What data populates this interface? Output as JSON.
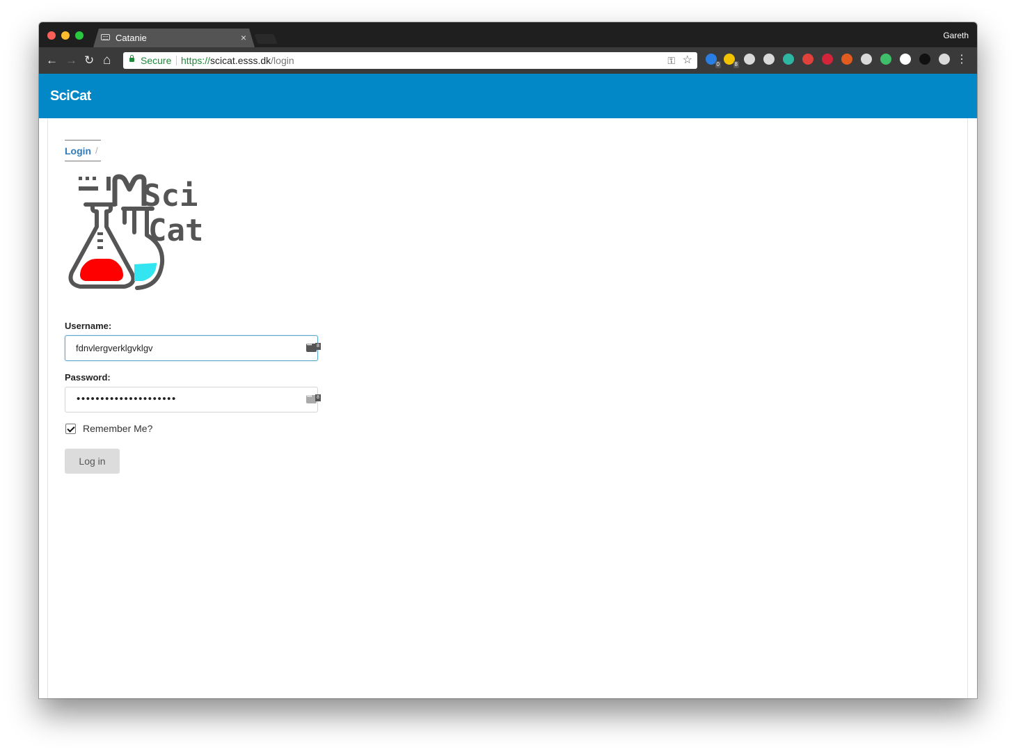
{
  "browser": {
    "tab_title": "Catanie",
    "tab_close": "×",
    "profile_name": "Gareth",
    "omnibox": {
      "secure_label": "Secure",
      "url_scheme": "https://",
      "url_host": "scicat.esss.dk",
      "url_path": "/login"
    },
    "nav": {
      "back": "←",
      "forward": "→",
      "reload": "↻",
      "home": "⌂"
    },
    "extensions": [
      {
        "name": "extension-blue",
        "color": "#2a7de1",
        "badge": "0"
      },
      {
        "name": "extension-yellow",
        "color": "#f2c200",
        "badge": "8"
      },
      {
        "name": "extension-1",
        "color": "#d9d9d9"
      },
      {
        "name": "extension-2",
        "color": "#d9d9d9"
      },
      {
        "name": "extension-s",
        "color": "#2fb6a2"
      },
      {
        "name": "extension-red",
        "color": "#e0413b"
      },
      {
        "name": "extension-red-square",
        "color": "#d3243a"
      },
      {
        "name": "extension-orange",
        "color": "#e25c1f"
      },
      {
        "name": "extension-3",
        "color": "#d9d9d9"
      },
      {
        "name": "extension-green-ring",
        "color": "#3fbf6a"
      },
      {
        "name": "extension-4",
        "color": "#ffffff"
      },
      {
        "name": "extension-lock",
        "color": "#111111"
      },
      {
        "name": "extension-hex",
        "color": "#d9d9d9"
      }
    ]
  },
  "app": {
    "brand": "SciCat",
    "brand_color": "#0288c7",
    "breadcrumb": {
      "current": "Login",
      "separator": "/"
    },
    "logo": {
      "line1": "Sci",
      "line2": "Cat"
    },
    "form": {
      "username_label": "Username:",
      "username_value": "fdnvlergverklgvklgv",
      "password_label": "Password:",
      "password_mask": "•••••••••••••••••••••",
      "password_manager_badge": "8",
      "remember_label": "Remember Me?",
      "remember_checked": true,
      "submit_label": "Log in"
    }
  }
}
